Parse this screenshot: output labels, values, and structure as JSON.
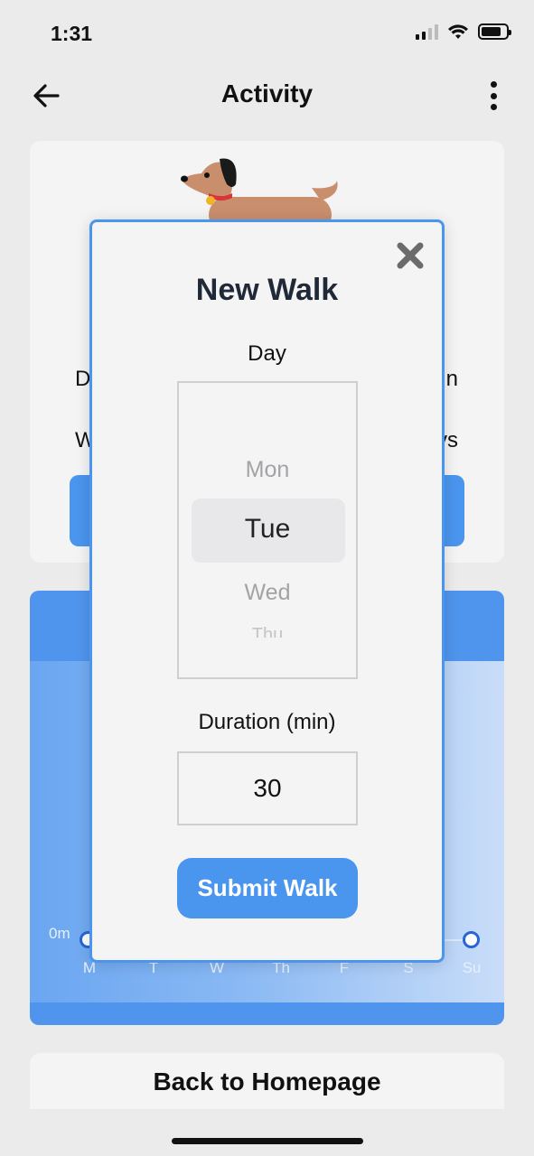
{
  "status_bar": {
    "time": "1:31"
  },
  "header": {
    "title": "Activity"
  },
  "profile_card": {
    "row1_left": "D",
    "row1_right": "n",
    "row2_left": "W",
    "row2_right": "ys"
  },
  "chart": {
    "zero_label": "0m",
    "days": [
      "M",
      "T",
      "W",
      "Th",
      "F",
      "S",
      "Su"
    ]
  },
  "modal": {
    "title": "New Walk",
    "day_label": "Day",
    "day_options": [
      "Mon",
      "Tue",
      "Wed",
      "Thu"
    ],
    "selected_day": "Tue",
    "duration_label": "Duration (min)",
    "duration_value": "30",
    "submit_label": "Submit Walk"
  },
  "footer": {
    "home_label": "Back to Homepage"
  },
  "colors": {
    "accent": "#4a95ee",
    "title": "#1f2937",
    "background": "#ebebeb"
  }
}
